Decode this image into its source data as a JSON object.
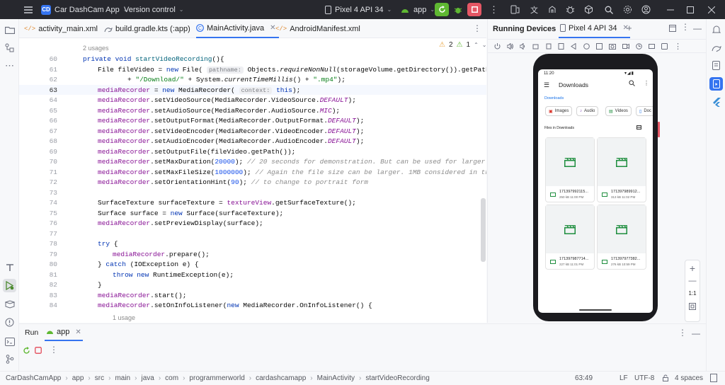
{
  "titlebar": {
    "project_badge": "CD",
    "project_name": "Car DashCam App",
    "vcs": "Version control",
    "device": "Pixel 4 API 34",
    "run_config": "app"
  },
  "tabs": [
    {
      "label": "activity_main.xml"
    },
    {
      "label": "build.gradle.kts (:app)"
    },
    {
      "label": "MainActivity.java"
    },
    {
      "label": "AndroidManifest.xml"
    }
  ],
  "editor": {
    "usages": "2 usages",
    "warnings": "2",
    "weak_warnings": "1",
    "usages_bottom": "1 usage",
    "line_numbers": [
      "60",
      "61",
      "62",
      "63",
      "64",
      "65",
      "66",
      "67",
      "68",
      "69",
      "70",
      "71",
      "72",
      "73",
      "74",
      "75",
      "76",
      "77",
      "78",
      "79",
      "80",
      "81",
      "82",
      "83",
      "84"
    ]
  },
  "devices": {
    "title": "Running Devices",
    "device_tab": "Pixel 4 API 34",
    "zoom_label": "1:1"
  },
  "phone": {
    "time": "11:20",
    "app_title": "Downloads",
    "breadcrumb": "Downloads",
    "chips": [
      "Images",
      "Audio",
      "Videos",
      "Doc"
    ],
    "section": "Files in Downloads",
    "files": [
      {
        "name": "171397992115...",
        "meta": "250 kB  11:00 PM"
      },
      {
        "name": "171397989912...",
        "meta": "313 kB  11:02 PM"
      },
      {
        "name": "171397987714...",
        "meta": "227 kB  11:01 PM"
      },
      {
        "name": "171397977382...",
        "meta": "276 kB  10:59 PM"
      }
    ]
  },
  "runpanel": {
    "run_tab": "Run",
    "app_tab": "app"
  },
  "status": {
    "crumbs": [
      "CarDashCamApp",
      "app",
      "src",
      "main",
      "java",
      "com",
      "programmerworld",
      "cardashcamapp",
      "MainActivity",
      "startVideoRecording"
    ],
    "position": "63:49",
    "line_sep": "LF",
    "encoding": "UTF-8",
    "indent": "4 spaces"
  },
  "colors": {
    "accent": "#3574f0",
    "run_green": "#5fb832",
    "stop_red": "#e55765",
    "android_green": "#1e8e3e"
  }
}
